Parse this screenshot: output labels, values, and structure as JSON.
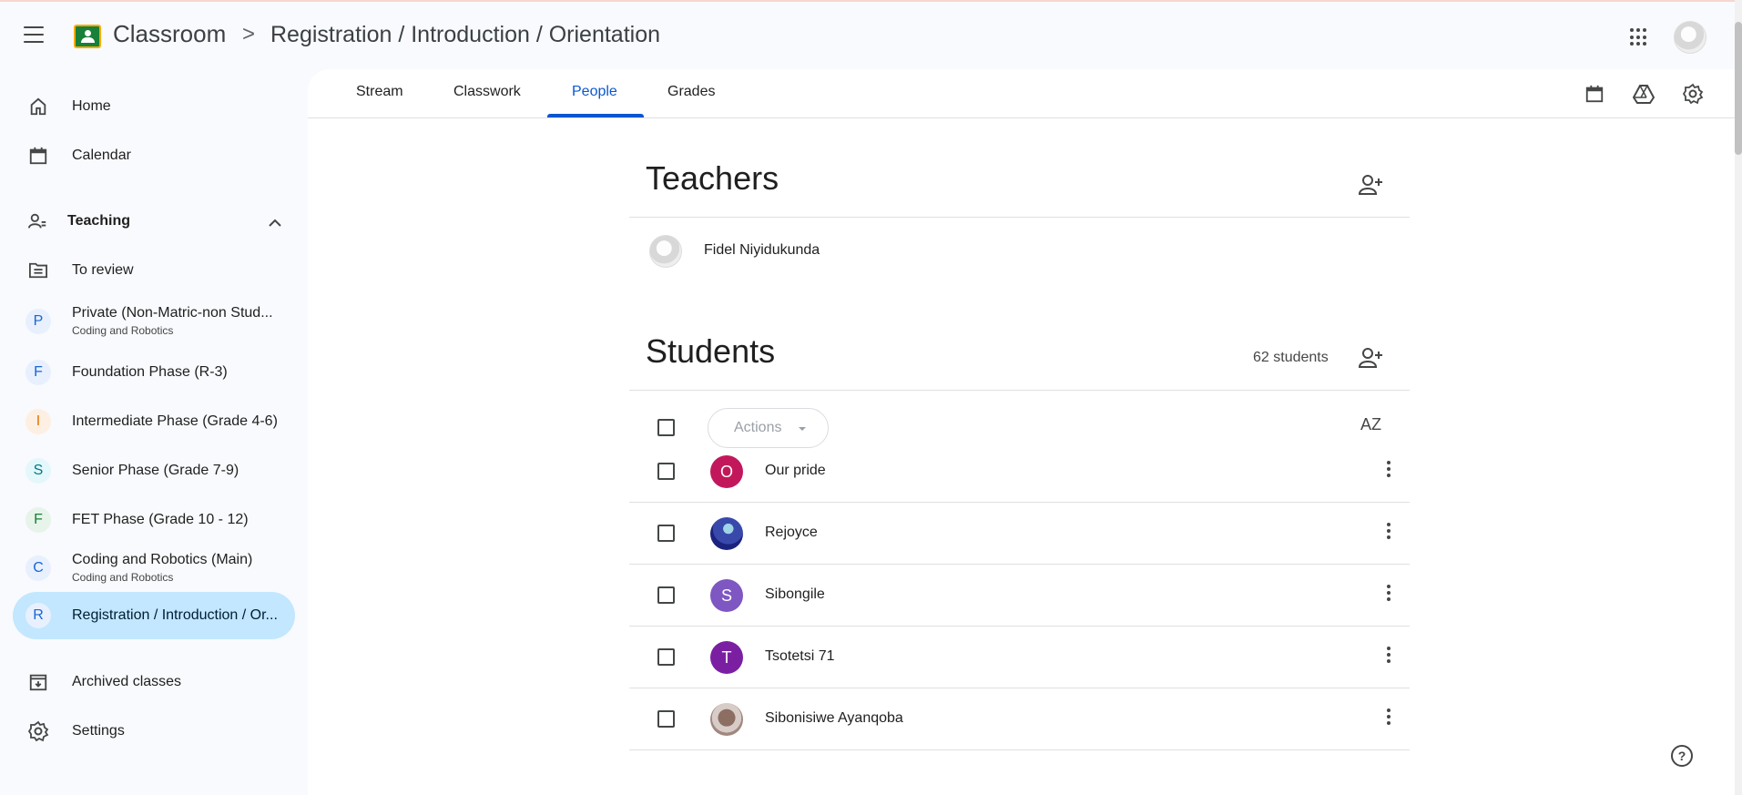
{
  "header": {
    "app_title": "Classroom",
    "separator": ">",
    "breadcrumb": "Registration / Introduction / Orientation"
  },
  "sidebar": {
    "home": "Home",
    "calendar": "Calendar",
    "teaching": "Teaching",
    "to_review": "To review",
    "classes": [
      {
        "initial": "P",
        "name": "Private (Non-Matric-non Stud...",
        "sub": "Coding and Robotics",
        "color": "#1967d2",
        "bg": "#e8f0fe"
      },
      {
        "initial": "F",
        "name": "Foundation Phase (R-3)",
        "sub": "",
        "color": "#1967d2",
        "bg": "#e8f0fe"
      },
      {
        "initial": "I",
        "name": "Intermediate Phase (Grade 4-6)",
        "sub": "",
        "color": "#e37400",
        "bg": "#feefe3"
      },
      {
        "initial": "S",
        "name": "Senior Phase (Grade 7-9)",
        "sub": "",
        "color": "#007b83",
        "bg": "#e4f7fb"
      },
      {
        "initial": "F",
        "name": "FET Phase (Grade 10 - 12)",
        "sub": "",
        "color": "#188038",
        "bg": "#e6f4ea"
      },
      {
        "initial": "C",
        "name": "Coding and Robotics (Main)",
        "sub": "Coding and Robotics",
        "color": "#1967d2",
        "bg": "#e8f0fe"
      },
      {
        "initial": "R",
        "name": "Registration / Introduction / Or...",
        "sub": "",
        "color": "#1967d2",
        "bg": "#e8f0fe"
      }
    ],
    "archived": "Archived classes",
    "settings": "Settings"
  },
  "tabs": [
    "Stream",
    "Classwork",
    "People",
    "Grades"
  ],
  "active_tab": "People",
  "teachers": {
    "title": "Teachers",
    "list": [
      {
        "name": "Fidel Niyidukunda"
      }
    ]
  },
  "students": {
    "title": "Students",
    "count": "62 students",
    "actions_label": "Actions",
    "sort_label": "AZ",
    "list": [
      {
        "name": "Our pride",
        "initial": "O",
        "color": "#c2185b"
      },
      {
        "name": "Rejoyce",
        "initial": "",
        "color": "#1a237e"
      },
      {
        "name": "Sibongile",
        "initial": "S",
        "color": "#7e57c2"
      },
      {
        "name": "Tsotetsi 71",
        "initial": "T",
        "color": "#7b1fa2"
      },
      {
        "name": "Sibonisiwe Ayanqoba",
        "initial": "",
        "color": "#a1887f"
      }
    ]
  },
  "help_label": "?"
}
